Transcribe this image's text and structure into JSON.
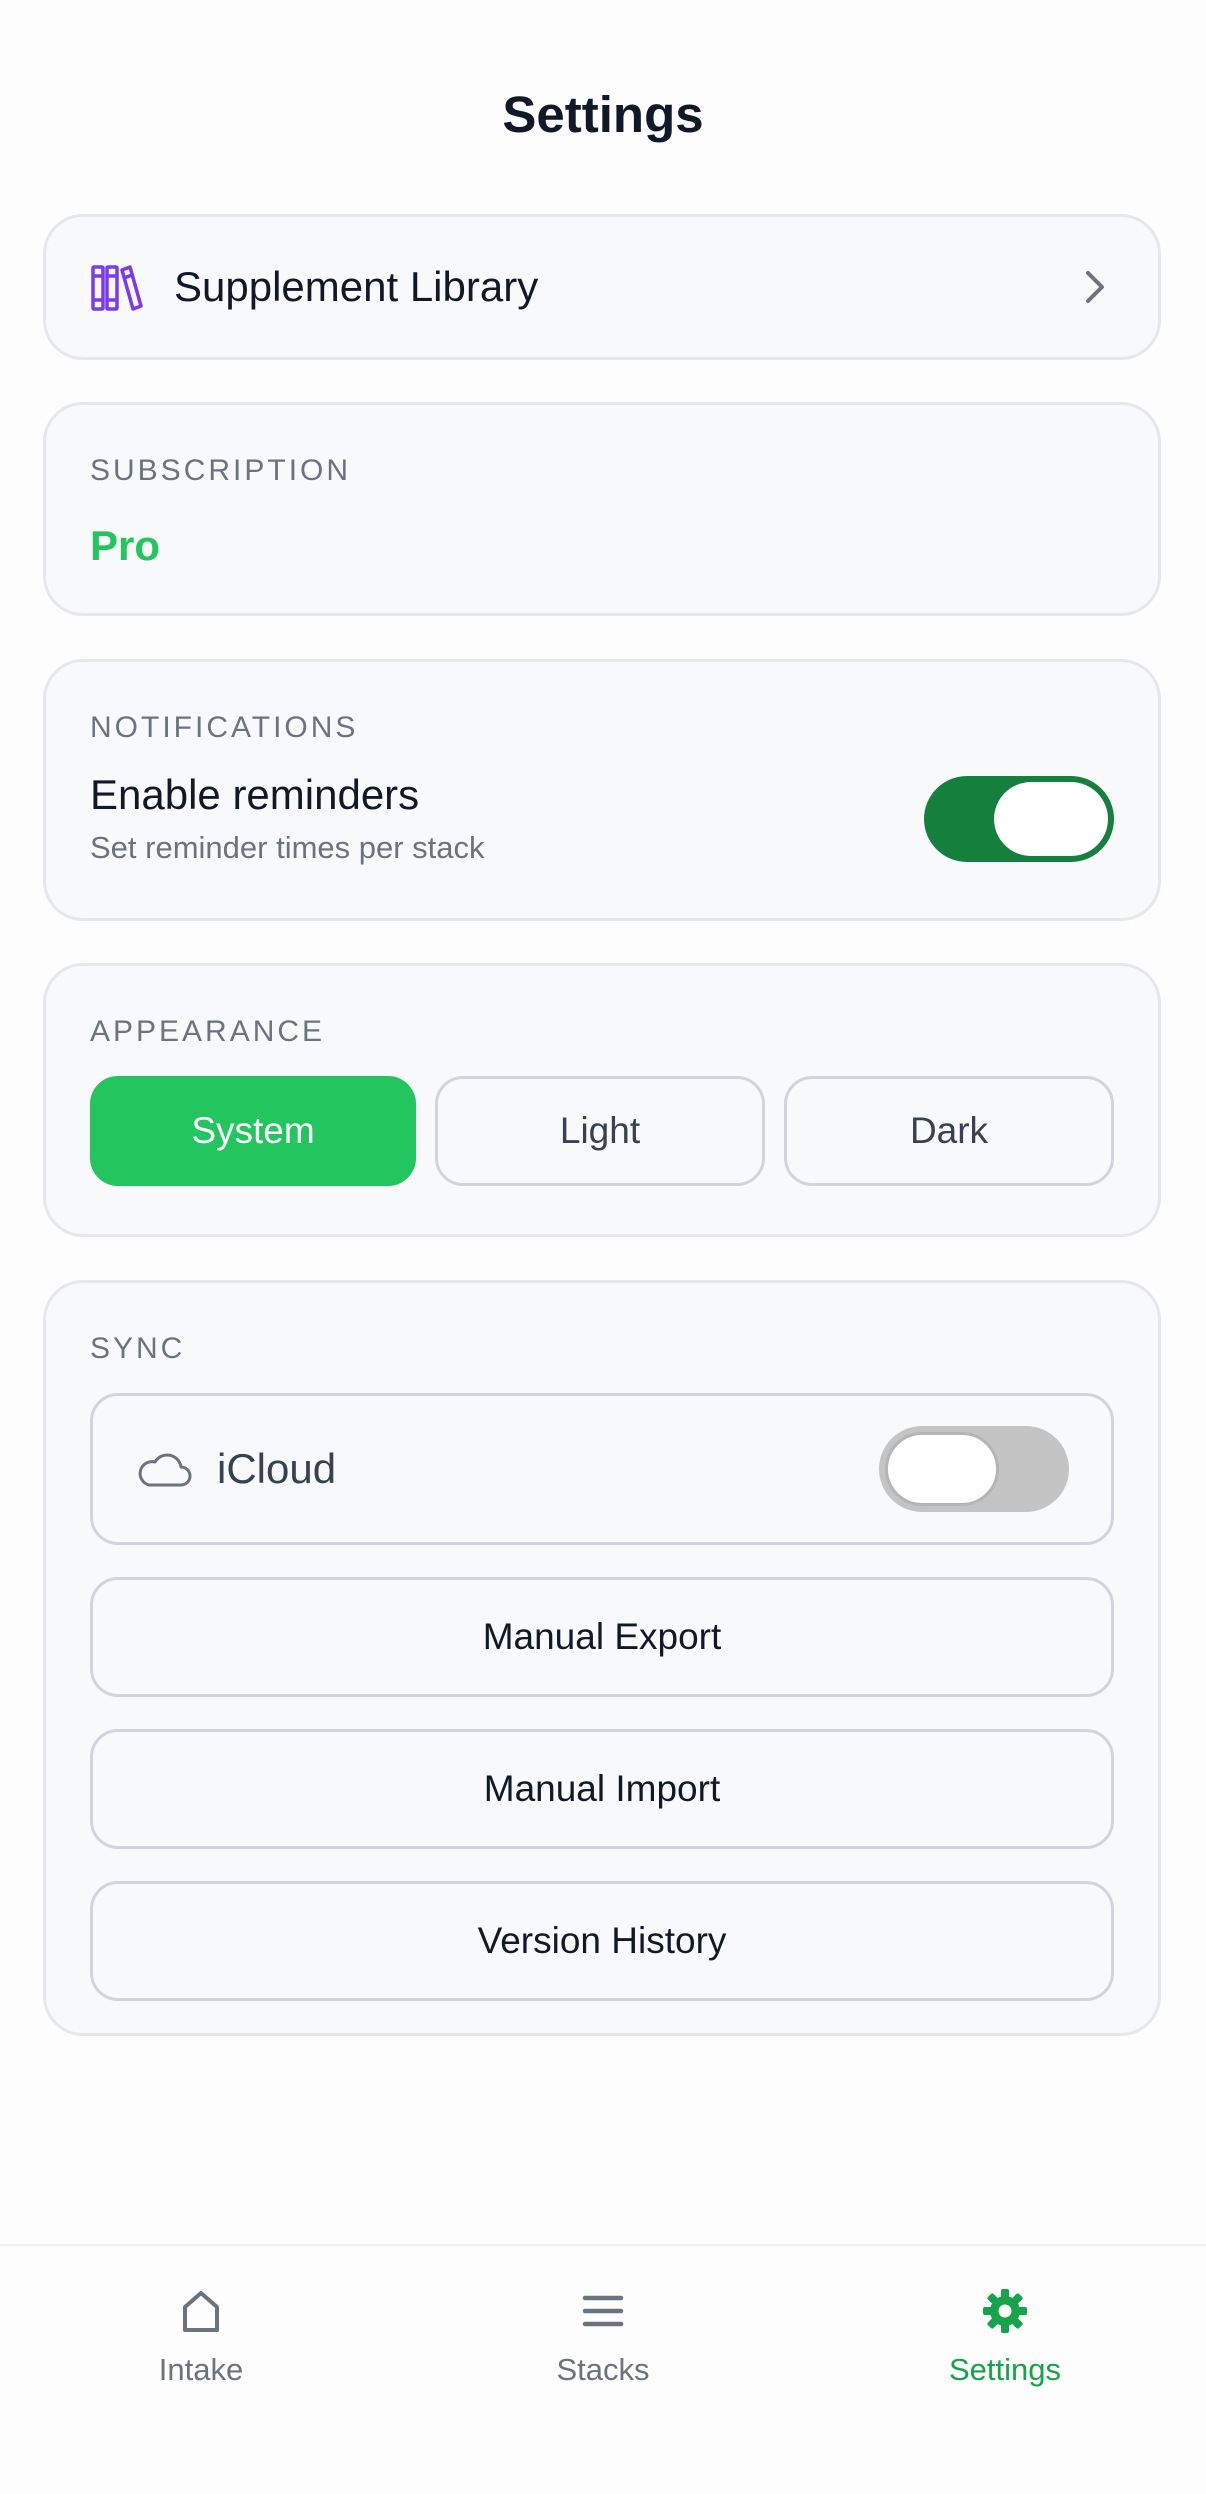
{
  "page": {
    "title": "Settings"
  },
  "library": {
    "label": "Supplement Library",
    "icon": "books-icon",
    "accent": "#7c3aed"
  },
  "subscription": {
    "section_label": "SUBSCRIPTION",
    "plan": "Pro",
    "plan_color": "#22c55e"
  },
  "notifications": {
    "section_label": "NOTIFICATIONS",
    "title": "Enable reminders",
    "subtitle": "Set reminder times per stack",
    "enabled": true
  },
  "appearance": {
    "section_label": "APPEARANCE",
    "options": [
      "System",
      "Light",
      "Dark"
    ],
    "selected": "System"
  },
  "sync": {
    "section_label": "SYNC",
    "icloud_label": "iCloud",
    "icloud_enabled": false,
    "buttons": [
      "Manual Export",
      "Manual Import",
      "Version History"
    ]
  },
  "tabbar": {
    "tabs": [
      {
        "label": "Intake",
        "icon": "home-icon",
        "active": false
      },
      {
        "label": "Stacks",
        "icon": "list-icon",
        "active": false
      },
      {
        "label": "Settings",
        "icon": "gear-icon",
        "active": true
      }
    ],
    "active_color": "#16a34a",
    "inactive_color": "#6b7280"
  }
}
